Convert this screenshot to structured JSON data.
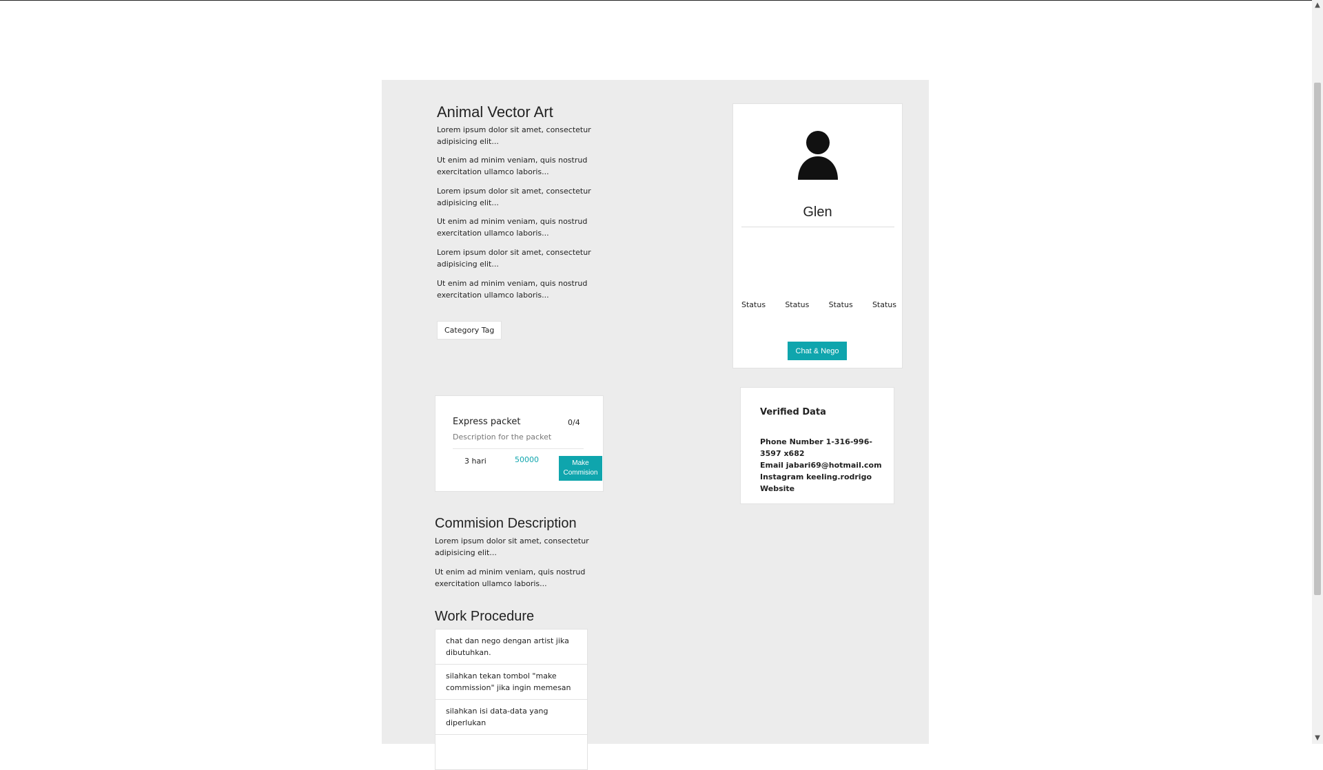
{
  "header": {
    "title": "Animal Vector Art"
  },
  "intro_paragraphs": [
    "Lorem ipsum dolor sit amet, consectetur adipisicing elit...",
    "Ut enim ad minim veniam, quis nostrud exercitation ullamco laboris...",
    "Lorem ipsum dolor sit amet, consectetur adipisicing elit...",
    "Ut enim ad minim veniam, quis nostrud exercitation ullamco laboris...",
    "Lorem ipsum dolor sit amet, consectetur adipisicing elit...",
    "Ut enim ad minim veniam, quis nostrud exercitation ullamco laboris..."
  ],
  "category_tag": "Category Tag",
  "profile": {
    "name": "Glen",
    "statuses": [
      "Status",
      "Status",
      "Status",
      "Status"
    ],
    "chat_button": "Chat & Nego",
    "avatar_icon": "user-silhouette-icon"
  },
  "verified": {
    "title": "Verified Data",
    "phone": "Phone Number 1-316-996-3597 x682",
    "email": "Email jabari69@hotmail.com",
    "instagram": "Instagram keeling.rodrigo",
    "website": "Website"
  },
  "packet": {
    "name": "Express packet",
    "count": "0/4",
    "description": "Description for the packet",
    "duration": "3 hari",
    "price": "50000",
    "button": "Make Commision"
  },
  "commission": {
    "title": "Commision Description",
    "paragraphs": [
      "Lorem ipsum dolor sit amet, consectetur adipisicing elit...",
      "Ut enim ad minim veniam, quis nostrud exercitation ullamco laboris..."
    ]
  },
  "procedure": {
    "title": "Work Procedure",
    "steps": [
      "chat dan nego dengan artist jika dibutuhkan.",
      "silahkan tekan tombol \"make commission\" jika ingin memesan",
      "silahkan isi data-data yang diperlukan"
    ]
  },
  "colors": {
    "accent": "#0fa5ad",
    "panel": "#ececec",
    "card": "#ffffff"
  }
}
